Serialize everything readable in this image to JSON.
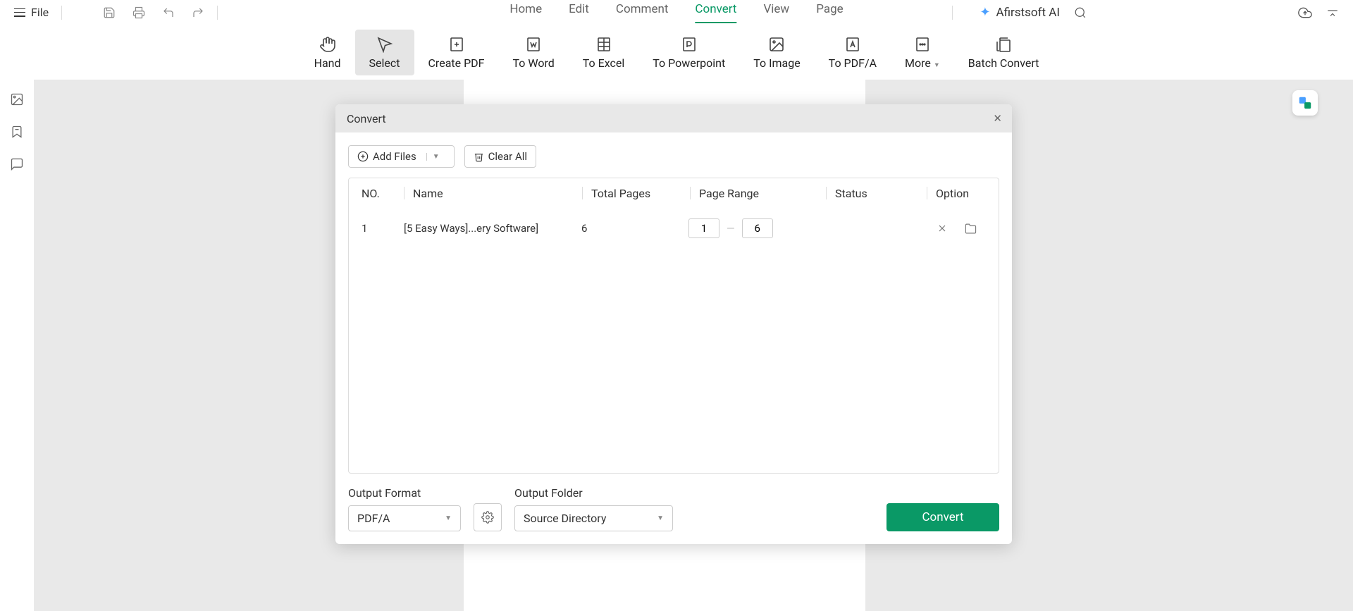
{
  "top": {
    "file_label": "File",
    "tabs": [
      "Home",
      "Edit",
      "Comment",
      "Convert",
      "View",
      "Page"
    ],
    "active_tab": "Convert",
    "ai_label": "Afirstsoft AI"
  },
  "ribbon": {
    "items": [
      {
        "label": "Hand"
      },
      {
        "label": "Select"
      },
      {
        "label": "Create PDF"
      },
      {
        "label": "To Word"
      },
      {
        "label": "To Excel"
      },
      {
        "label": "To Powerpoint"
      },
      {
        "label": "To Image"
      },
      {
        "label": "To PDF/A"
      },
      {
        "label": "More"
      },
      {
        "label": "Batch Convert"
      }
    ],
    "active_index": 1
  },
  "dialog": {
    "title": "Convert",
    "add_files_label": "Add Files",
    "clear_all_label": "Clear All",
    "columns": {
      "no": "NO.",
      "name": "Name",
      "total_pages": "Total Pages",
      "page_range": "Page Range",
      "status": "Status",
      "option": "Option"
    },
    "rows": [
      {
        "no": "1",
        "name": "[5 Easy Ways]...ery Software]",
        "total_pages": "6",
        "range_from": "1",
        "range_to": "6",
        "status": ""
      }
    ],
    "footer": {
      "output_format_label": "Output Format",
      "output_format_value": "PDF/A",
      "output_folder_label": "Output Folder",
      "output_folder_value": "Source Directory",
      "convert_label": "Convert"
    }
  }
}
